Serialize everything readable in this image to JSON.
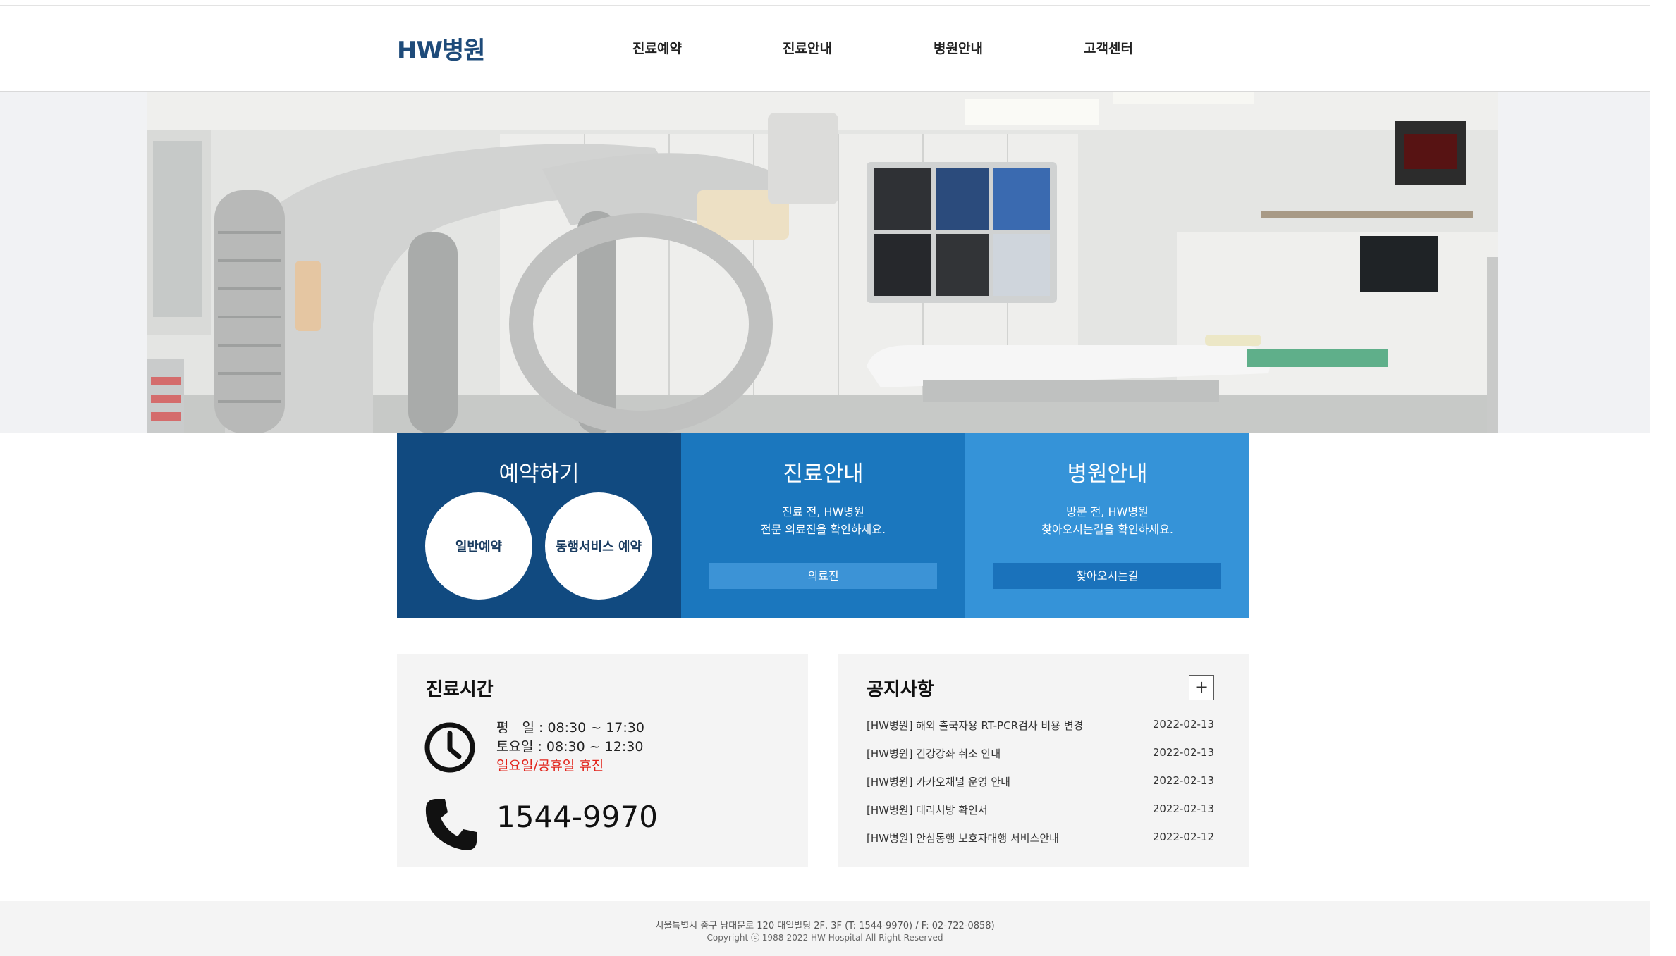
{
  "header": {
    "logo": "HW병원",
    "nav": [
      "진료예약",
      "진료안내",
      "병원안내",
      "고객센터"
    ]
  },
  "hero": {
    "image": "hospital-angiography-room"
  },
  "features": {
    "reserve": {
      "title": "예약하기",
      "general": "일반예약",
      "escort": "동행서비스 예약"
    },
    "care": {
      "title": "진료안내",
      "line1": "진료 전, HW병원",
      "line2": "전문 의료진을 확인하세요.",
      "button": "의료진"
    },
    "hospital": {
      "title": "병원안내",
      "line1": "방문 전, HW병원",
      "line2": "찾아오시는길을 확인하세요.",
      "button": "찾아오시는길"
    }
  },
  "hours": {
    "title": "진료시간",
    "weekday": "평　일 : 08:30 ~ 17:30",
    "saturday": "토요일 : 08:30 ~ 12:30",
    "closed": "일요일/공휴일 휴진",
    "phone": "1544-9970"
  },
  "notice": {
    "title": "공지사항",
    "more": "+",
    "items": [
      {
        "title": "[HW병원] 해외 출국자용 RT-PCR검사 비용 변경",
        "date": "2022-02-13"
      },
      {
        "title": "[HW병원] 건강강좌 취소 안내",
        "date": "2022-02-13"
      },
      {
        "title": "[HW병원] 카카오채널 운영 안내",
        "date": "2022-02-13"
      },
      {
        "title": "[HW병원] 대리처방 확인서",
        "date": "2022-02-13"
      },
      {
        "title": "[HW병원] 안심동행 보호자대행 서비스안내",
        "date": "2022-02-12"
      }
    ]
  },
  "footer": {
    "address": "서울특별시 중구 남대문로 120 대일빌딩 2F, 3F (T: 1544-9970) / F: 02-722-0858)",
    "copyright": "Copyright ⓒ 1988-2022 HW Hospital All Right Reserved"
  },
  "colors": {
    "navy": "#114a80",
    "blue": "#1b77be",
    "light_blue": "#3593d8",
    "closed_red": "#e2241b",
    "logo": "#1e4b7a"
  }
}
